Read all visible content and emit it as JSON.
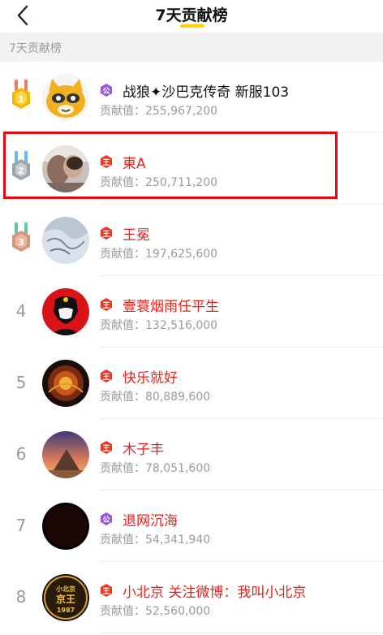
{
  "header": {
    "title": "7天贡献榜",
    "back_icon": "back-arrow-icon"
  },
  "section": {
    "label": "7天贡献榜"
  },
  "colors": {
    "accent": "#ffd200",
    "name_red": "#e8211b",
    "highlight": "#e8070e",
    "gray_text": "#9a9a9a"
  },
  "contrib_label": "贡献值：",
  "entries": [
    {
      "rank": "1",
      "medal": "gold-medal-icon",
      "badge": "gong",
      "badge_text": "公",
      "name": "战狼✦沙巴克传奇 新服103",
      "value": "255,967,200",
      "name_color": "black"
    },
    {
      "rank": "2",
      "medal": "silver-medal-icon",
      "badge": "wang",
      "badge_text": "王",
      "name": "東A",
      "value": "250,711,200",
      "name_color": "red"
    },
    {
      "rank": "3",
      "medal": "bronze-medal-icon",
      "badge": "wang",
      "badge_text": "王",
      "name": "王冕",
      "value": "197,625,600",
      "name_color": "red"
    },
    {
      "rank": "4",
      "badge": "wang",
      "badge_text": "王",
      "name": "壹蓑烟雨任平生",
      "value": "132,516,000",
      "name_color": "red"
    },
    {
      "rank": "5",
      "badge": "wang",
      "badge_text": "王",
      "name": "快乐就好",
      "value": "80,889,600",
      "name_color": "red"
    },
    {
      "rank": "6",
      "badge": "wang",
      "badge_text": "王",
      "name": "木子丰",
      "value": "78,051,600",
      "name_color": "red"
    },
    {
      "rank": "7",
      "badge": "gong",
      "badge_text": "公",
      "name": "退网沉海",
      "value": "54,341,940",
      "name_color": "red"
    },
    {
      "rank": "8",
      "badge": "wang",
      "badge_text": "王",
      "name": "小北京 关注微博：我叫小北京",
      "value": "52,560,000",
      "name_color": "red"
    }
  ],
  "avatar_texts": {
    "row8_line1": "小北京",
    "row8_line2": "京王",
    "row8_line3": "1987"
  }
}
